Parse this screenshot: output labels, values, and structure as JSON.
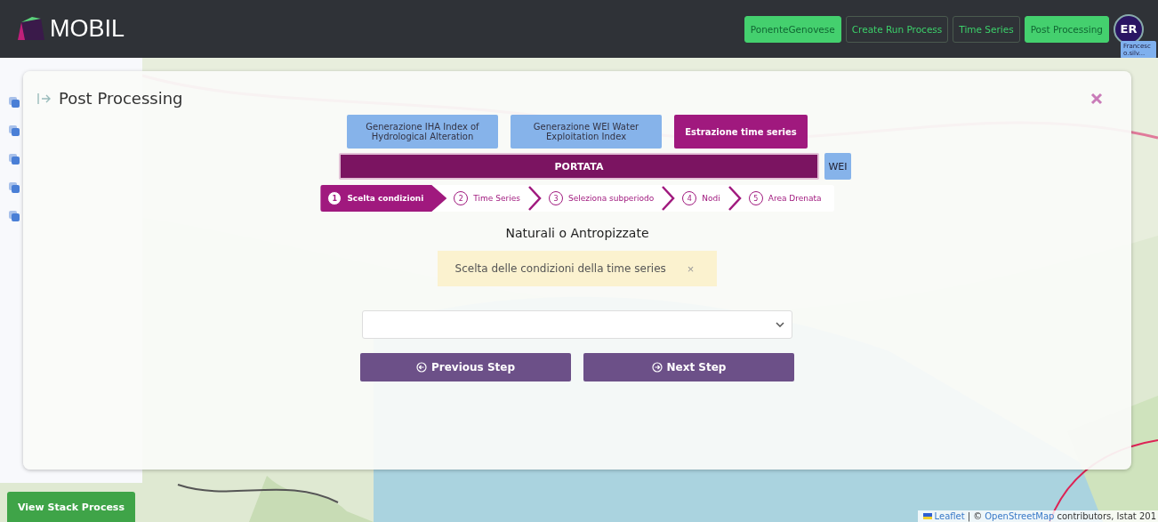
{
  "header": {
    "logo": "MOBIL",
    "nav": [
      {
        "label": "PonenteGenovese",
        "selected": true
      },
      {
        "label": "Create Run Process",
        "selected": false
      },
      {
        "label": "Time Series",
        "selected": false
      },
      {
        "label": "Post Processing",
        "selected": true
      }
    ],
    "avatar": "ER",
    "user_tooltip": "Francesco.silv..."
  },
  "modal": {
    "title": "Post Processing",
    "process_tabs": [
      {
        "label": "Generazione IHA Index of Hydrological Alteration",
        "selected": false
      },
      {
        "label": "Generazione WEI Water Exploitation Index",
        "selected": false
      },
      {
        "label": "Estrazione time series",
        "selected": true
      }
    ],
    "sub_tabs": [
      {
        "label": "PORTATA",
        "selected": true
      },
      {
        "label": "WEI",
        "selected": false
      }
    ],
    "steps": [
      {
        "number": "1",
        "label": "Scelta condizioni",
        "selected": true
      },
      {
        "number": "2",
        "label": "Time Series",
        "selected": false
      },
      {
        "number": "3",
        "label": "Seleziona subperiodo",
        "selected": false
      },
      {
        "number": "4",
        "label": "Nodi",
        "selected": false
      },
      {
        "number": "5",
        "label": "Area Drenata",
        "selected": false
      }
    ],
    "heading": "Naturali o Antropizzate",
    "alert": "Scelta delle condizioni della time series",
    "alert_close": "×",
    "buttons": [
      "Previous Step",
      "Next Step"
    ]
  },
  "view_stack_button": "View Stack Process",
  "attribution": {
    "leaflet": "Leaflet",
    "separator": "| ©",
    "osm": "OpenStreetMap",
    "rest": "contributors, Istat 201"
  }
}
